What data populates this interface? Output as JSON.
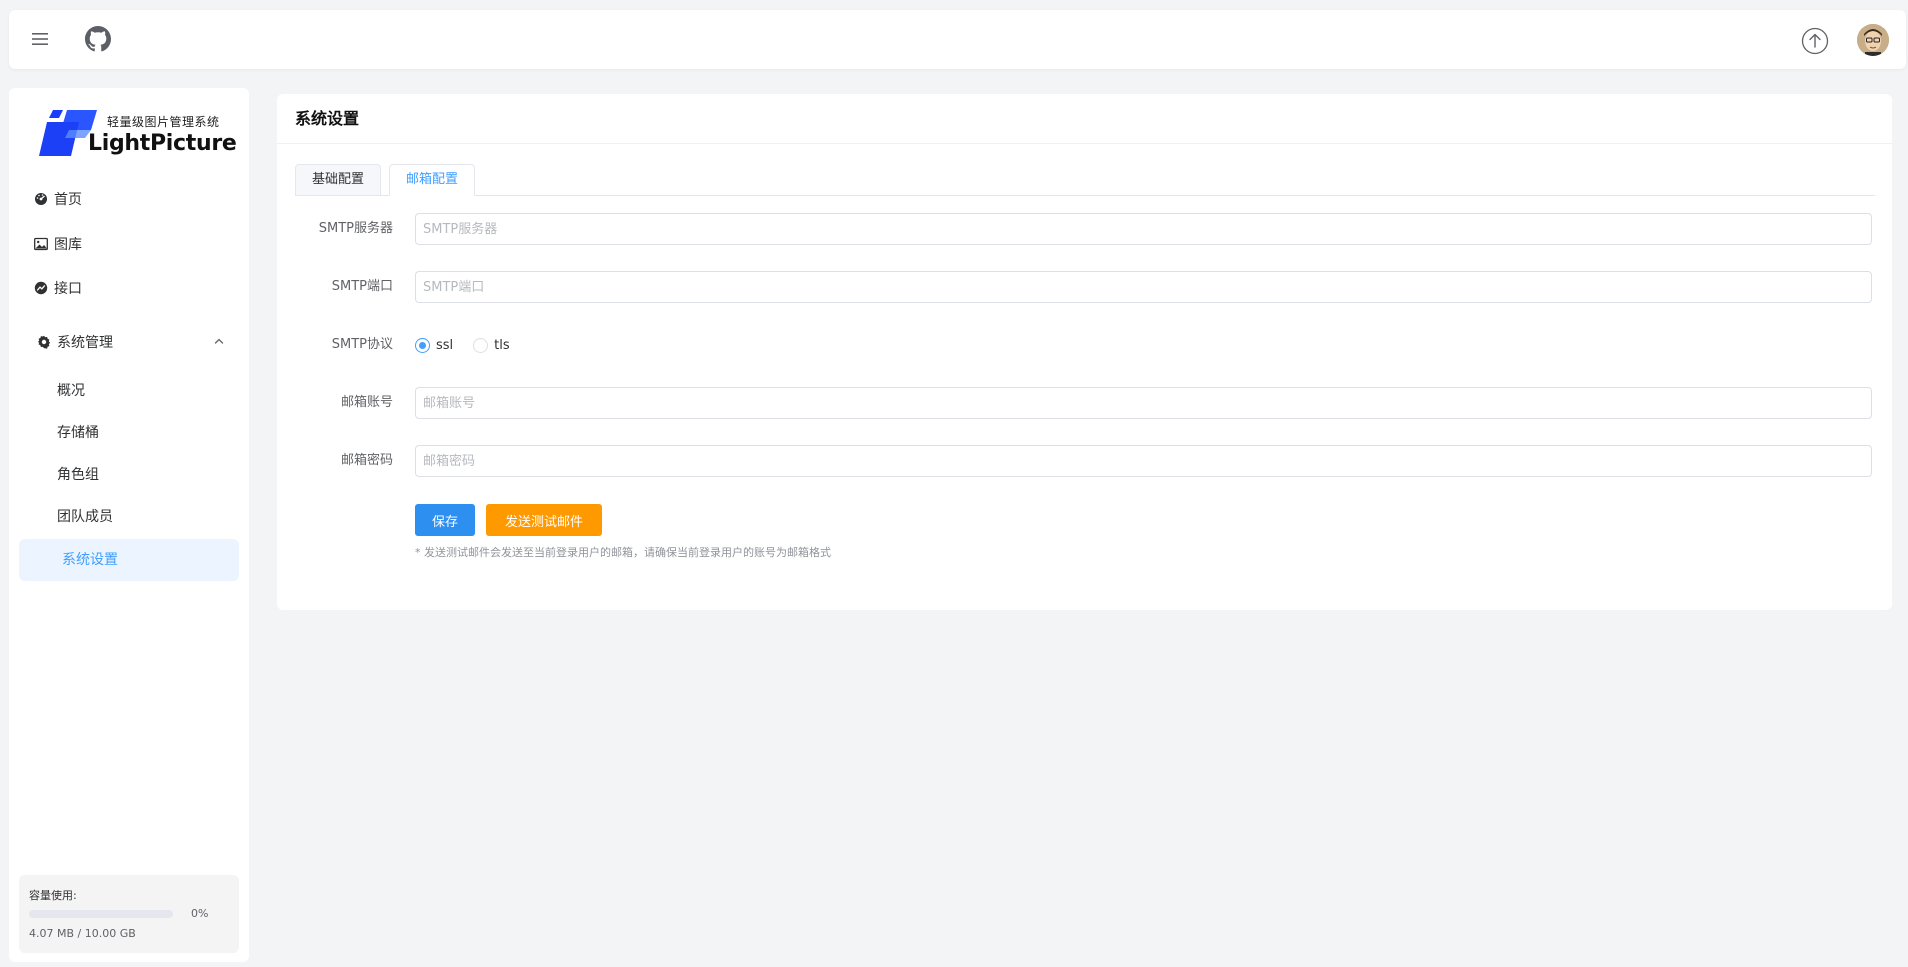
{
  "topbar": {
    "menu_icon": "hamburger-icon",
    "github_icon": "github-icon",
    "upload_icon": "upload-icon",
    "avatar": "user-avatar"
  },
  "sidebar": {
    "logo_subtitle": "轻量级图片管理系统",
    "logo_brand": "LightPicture",
    "items": [
      {
        "label": "首页",
        "icon": "dashboard-icon"
      },
      {
        "label": "图库",
        "icon": "image-icon"
      },
      {
        "label": "接口",
        "icon": "api-icon"
      }
    ],
    "group": {
      "label": "系统管理",
      "icon": "gear-icon",
      "expanded": true,
      "children": [
        "概况",
        "存储桶",
        "角色组",
        "团队成员",
        "系统设置"
      ],
      "active": "系统设置"
    },
    "capacity": {
      "label": "容量使用:",
      "percent_text": "0%",
      "percent": 0,
      "usage": "4.07 MB / 10.00 GB"
    }
  },
  "page": {
    "title": "系统设置",
    "tabs": [
      {
        "label": "基础配置",
        "active": false
      },
      {
        "label": "邮箱配置",
        "active": true
      }
    ],
    "form": {
      "smtp_server": {
        "label": "SMTP服务器",
        "value": "",
        "placeholder": "SMTP服务器"
      },
      "smtp_port": {
        "label": "SMTP端口",
        "value": "",
        "placeholder": "SMTP端口"
      },
      "smtp_protocol": {
        "label": "SMTP协议",
        "options": [
          "ssl",
          "tls"
        ],
        "selected": "ssl"
      },
      "email_account": {
        "label": "邮箱账号",
        "value": "",
        "placeholder": "邮箱账号"
      },
      "email_password": {
        "label": "邮箱密码",
        "value": "",
        "placeholder": "邮箱密码"
      }
    },
    "save_label": "保存",
    "send_test_label": "发送测试邮件",
    "note": "* 发送测试邮件会发送至当前登录用户的邮箱，请确保当前登录用户的账号为邮箱格式"
  },
  "colors": {
    "primary": "#409eff",
    "save_button": "#2d8ff0",
    "warning_button": "#ff9900",
    "background": "#f3f4f6"
  }
}
